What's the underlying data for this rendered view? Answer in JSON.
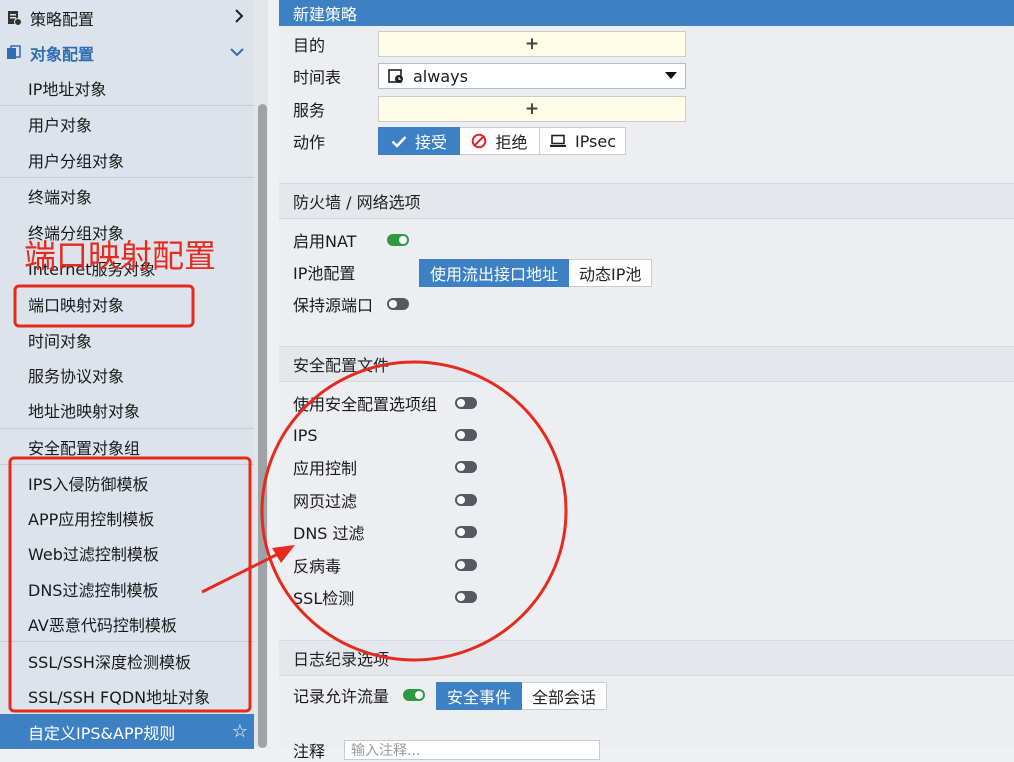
{
  "sidebar": {
    "top_items": [
      {
        "label": "策略配置",
        "icon": "policy-icon"
      },
      {
        "label": "对象配置",
        "icon": "object-config-icon"
      }
    ],
    "items": [
      {
        "label": "IP地址对象"
      },
      {
        "label": "用户对象"
      },
      {
        "label": "用户分组对象"
      },
      {
        "label": "终端对象"
      },
      {
        "label": "终端分组对象"
      },
      {
        "label": "Internet服务对象"
      },
      {
        "label": "端口映射对象"
      },
      {
        "label": "时间对象"
      },
      {
        "label": "服务协议对象"
      },
      {
        "label": "地址池映射对象"
      },
      {
        "label": "安全配置对象组"
      },
      {
        "label": "IPS入侵防御模板"
      },
      {
        "label": "APP应用控制模板"
      },
      {
        "label": "Web过滤控制模板"
      },
      {
        "label": "DNS过滤控制模板"
      },
      {
        "label": "AV恶意代码控制模板"
      },
      {
        "label": "SSL/SSH深度检测模板"
      },
      {
        "label": "SSL/SSH FQDN地址对象"
      },
      {
        "label": "自定义IPS&APP规则"
      }
    ]
  },
  "main": {
    "header": "新建策略",
    "destination": {
      "label": "目的",
      "value": "+"
    },
    "schedule": {
      "label": "时间表",
      "value": "always"
    },
    "service": {
      "label": "服务",
      "value": "+"
    },
    "action": {
      "label": "动作",
      "options": [
        "接受",
        "拒绝",
        "IPsec"
      ],
      "selected": "接受"
    },
    "firewall_section": {
      "title": "防火墙 / 网络选项",
      "nat": {
        "label": "启用NAT",
        "enabled": true
      },
      "ip_pool": {
        "label": "IP池配置",
        "options": [
          "使用流出接口地址",
          "动态IP池"
        ],
        "selected": "使用流出接口地址"
      },
      "keep_src_port": {
        "label": "保持源端口",
        "enabled": false
      }
    },
    "security_section": {
      "title": "安全配置文件",
      "items": [
        {
          "label": "使用安全配置选项组",
          "enabled": false
        },
        {
          "label": "IPS",
          "enabled": false
        },
        {
          "label": "应用控制",
          "enabled": false
        },
        {
          "label": "网页过滤",
          "enabled": false
        },
        {
          "label": "DNS 过滤",
          "enabled": false
        },
        {
          "label": "反病毒",
          "enabled": false
        },
        {
          "label": "SSL检测",
          "enabled": false
        }
      ]
    },
    "log_section": {
      "title": "日志纪录选项",
      "log_traffic": {
        "label": "记录允许流量",
        "enabled": true,
        "options": [
          "安全事件",
          "全部会话"
        ],
        "selected": "安全事件"
      },
      "comment": {
        "label": "注释",
        "placeholder": "输入注释..."
      }
    }
  },
  "annotation": {
    "label": "端口映射配置",
    "color": "#e62a1e"
  },
  "colors": {
    "accent": "#3d80c4",
    "toggle_on": "#2e9a3f",
    "annotation": "#e62a1e"
  }
}
